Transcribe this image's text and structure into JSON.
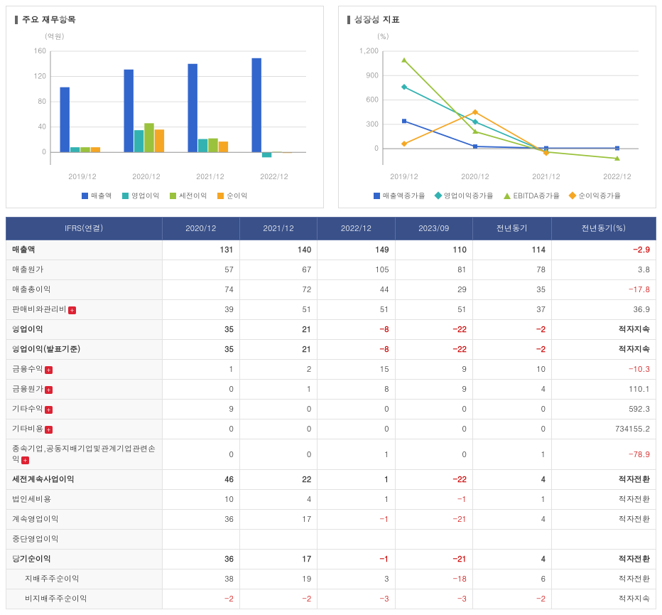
{
  "panel1": {
    "title": "주요 재무항목",
    "unit": "(억원)",
    "legend": [
      "매출액",
      "영업이익",
      "세전이익",
      "순이익"
    ],
    "colors": [
      "#3366cc",
      "#33b2b2",
      "#9ac23c",
      "#f5a623"
    ]
  },
  "panel2": {
    "title": "성장성 지표",
    "unit": "(%)",
    "legend": [
      "매출액증가율",
      "영업이익증가율",
      "EBITDA증가율",
      "순이익증가율"
    ],
    "colors": [
      "#3366cc",
      "#33b2b2",
      "#9ac23c",
      "#f5a623"
    ]
  },
  "chart_data": [
    {
      "type": "bar",
      "title": "주요 재무항목",
      "ylabel": "억원",
      "ylim": [
        0,
        160
      ],
      "categories": [
        "2019/12",
        "2020/12",
        "2021/12",
        "2022/12"
      ],
      "series": [
        {
          "name": "매출액",
          "values": [
            103,
            131,
            140,
            149
          ]
        },
        {
          "name": "영업이익",
          "values": [
            8,
            35,
            21,
            -8
          ]
        },
        {
          "name": "세전이익",
          "values": [
            8,
            46,
            22,
            1
          ]
        },
        {
          "name": "순이익",
          "values": [
            8,
            36,
            17,
            -1
          ]
        }
      ]
    },
    {
      "type": "line",
      "title": "성장성 지표",
      "ylabel": "%",
      "ylim": [
        -200,
        1200
      ],
      "categories": [
        "2019/12",
        "2020/12",
        "2021/12",
        "2022/12"
      ],
      "series": [
        {
          "name": "매출액증가율",
          "values": [
            340,
            27,
            6,
            6
          ]
        },
        {
          "name": "영업이익증가율",
          "values": [
            760,
            330,
            -40,
            null
          ]
        },
        {
          "name": "EBITDA증가율",
          "values": [
            1090,
            210,
            -40,
            -120
          ]
        },
        {
          "name": "순이익증가율",
          "values": [
            60,
            450,
            -53,
            null
          ]
        }
      ]
    }
  ],
  "table": {
    "header_first": "IFRS(연결)",
    "headers": [
      "2020/12",
      "2021/12",
      "2022/12",
      "2023/09",
      "전년동기",
      "전년동기(%)"
    ],
    "rows": [
      {
        "label": "매출액",
        "bold": true,
        "vals": [
          "131",
          "140",
          "149",
          "110",
          "114",
          "-2.9"
        ]
      },
      {
        "label": "매출원가",
        "vals": [
          "57",
          "67",
          "105",
          "81",
          "78",
          "3.8"
        ]
      },
      {
        "label": "매출총이익",
        "vals": [
          "74",
          "72",
          "44",
          "29",
          "35",
          "-17.8"
        ]
      },
      {
        "label": "판매비와관리비",
        "expand": true,
        "vals": [
          "39",
          "51",
          "51",
          "51",
          "37",
          "36.9"
        ]
      },
      {
        "label": "영업이익",
        "bold": true,
        "vals": [
          "35",
          "21",
          "-8",
          "-22",
          "-2",
          "적자지속"
        ]
      },
      {
        "label": "영업이익(발표기준)",
        "bold": true,
        "vals": [
          "35",
          "21",
          "-8",
          "-22",
          "-2",
          "적자지속"
        ]
      },
      {
        "label": "금융수익",
        "expand": true,
        "vals": [
          "1",
          "2",
          "15",
          "9",
          "10",
          "-10.3"
        ]
      },
      {
        "label": "금융원가",
        "expand": true,
        "vals": [
          "0",
          "1",
          "8",
          "9",
          "4",
          "110.1"
        ]
      },
      {
        "label": "기타수익",
        "expand": true,
        "vals": [
          "9",
          "0",
          "0",
          "0",
          "0",
          "592.3"
        ]
      },
      {
        "label": "기타비용",
        "expand": true,
        "vals": [
          "0",
          "0",
          "0",
          "0",
          "0",
          "734155.2"
        ]
      },
      {
        "label": "종속기업,공동지배기업및관계기업관련손익",
        "expand": true,
        "vals": [
          "0",
          "0",
          "1",
          "0",
          "1",
          "-78.9"
        ]
      },
      {
        "label": "세전계속사업이익",
        "bold": true,
        "vals": [
          "46",
          "22",
          "1",
          "-22",
          "4",
          "적자전환"
        ]
      },
      {
        "label": "법인세비용",
        "vals": [
          "10",
          "4",
          "1",
          "-1",
          "1",
          "적자전환"
        ]
      },
      {
        "label": "계속영업이익",
        "vals": [
          "36",
          "17",
          "-1",
          "-21",
          "4",
          "적자전환"
        ]
      },
      {
        "label": "중단영업이익",
        "vals": [
          "",
          "",
          "",
          "",
          "",
          ""
        ]
      },
      {
        "label": "당기순이익",
        "bold": true,
        "vals": [
          "36",
          "17",
          "-1",
          "-21",
          "4",
          "적자전환"
        ]
      },
      {
        "label": "지배주주순이익",
        "indent": true,
        "vals": [
          "38",
          "19",
          "3",
          "-18",
          "6",
          "적자전환"
        ]
      },
      {
        "label": "비지배주주순이익",
        "indent": true,
        "vals": [
          "-2",
          "-2",
          "-3",
          "-3",
          "-2",
          "적자지속"
        ]
      }
    ]
  }
}
